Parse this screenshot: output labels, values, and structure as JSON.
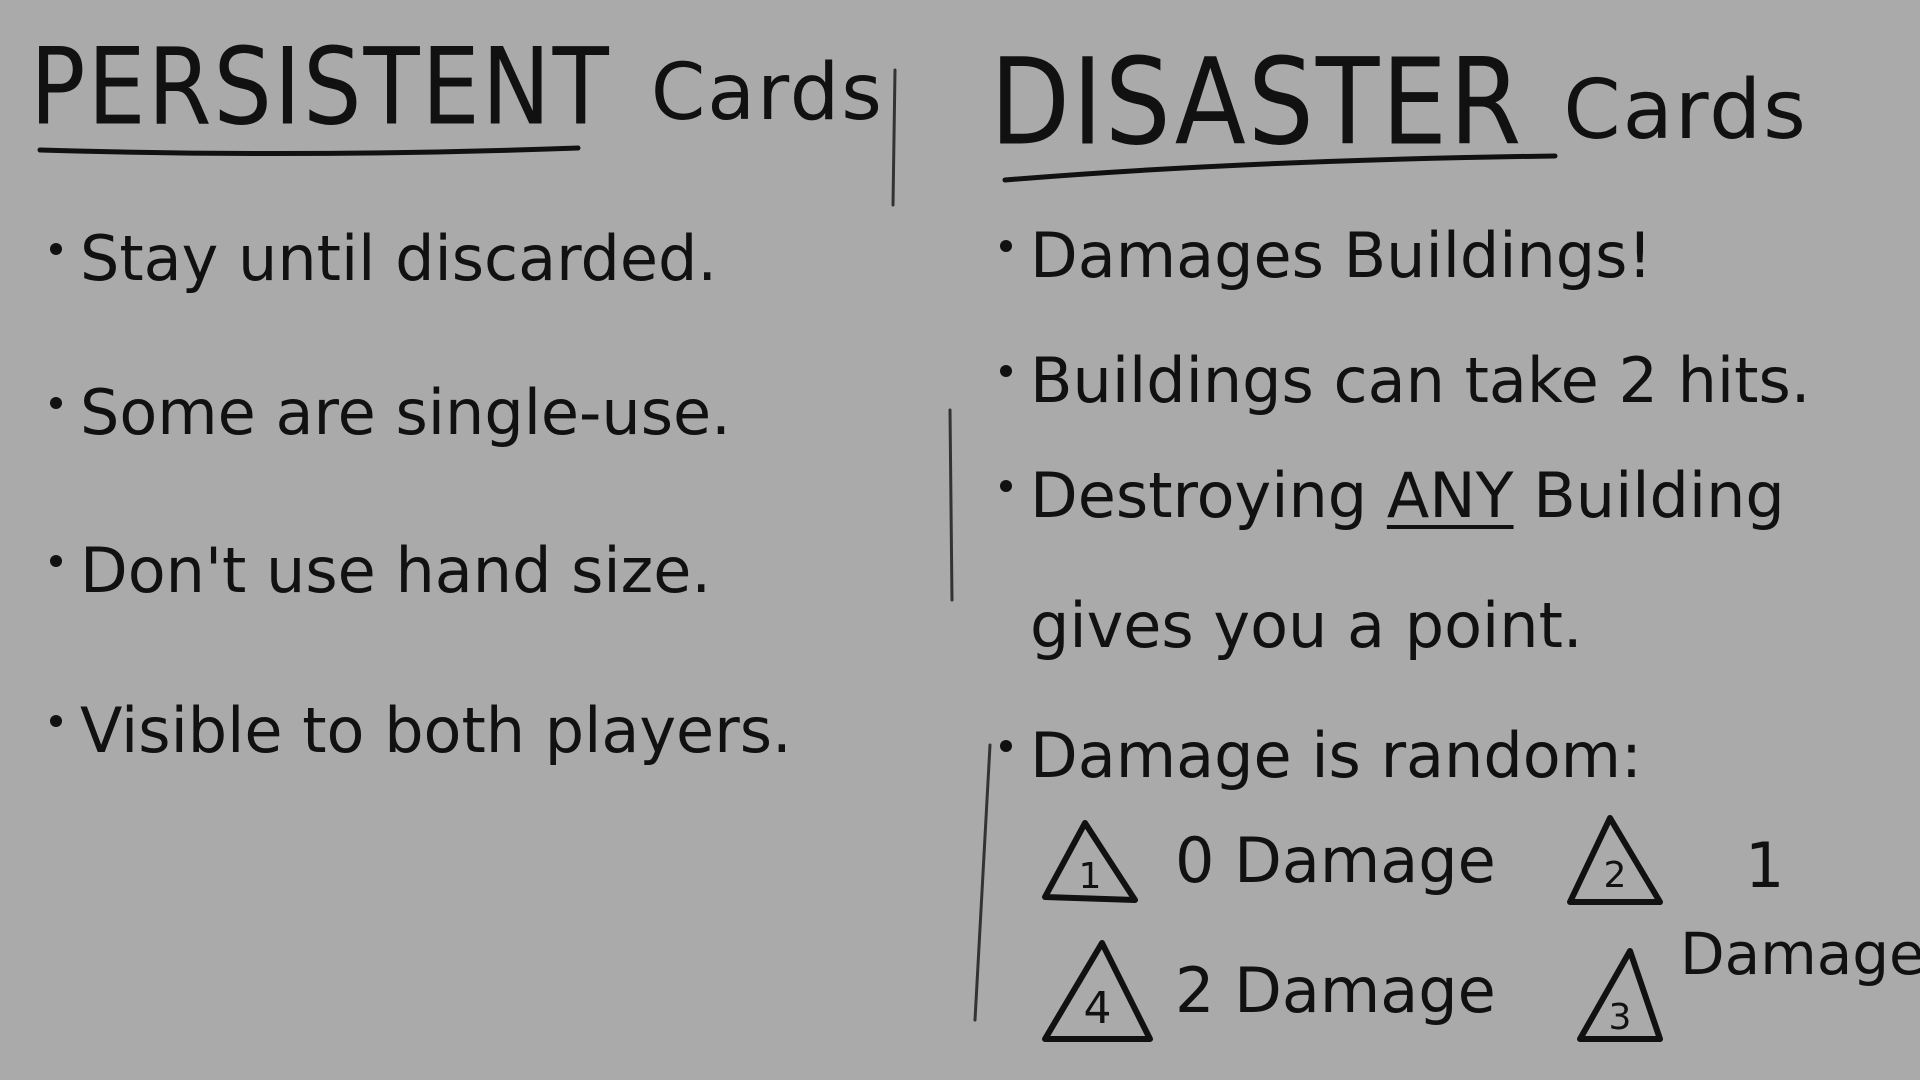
{
  "left": {
    "heading_main": "PERSISTENT",
    "heading_sub": "Cards",
    "bullets": [
      "Stay until discarded.",
      "Some are single-use.",
      "Don't use hand size.",
      "Visible to both players."
    ]
  },
  "right": {
    "heading_main": "DISASTER",
    "heading_sub": "Cards",
    "bullets": [
      "Damages Buildings!",
      "Buildings can take 2 hits.",
      "Destroying",
      "Damage is random:"
    ],
    "bullet3_emph": "ANY",
    "bullet3_tail": "Building",
    "bullet3_cont": "gives you a point.",
    "legend": [
      {
        "icon": "1",
        "label": "0 Damage"
      },
      {
        "icon": "2",
        "label_top": "1",
        "label_bottom": "Damage"
      },
      {
        "icon": "4",
        "label": "2 Damage"
      },
      {
        "icon": "3"
      }
    ]
  },
  "colors": {
    "background": "#aaaaaa",
    "ink": "#111111"
  }
}
